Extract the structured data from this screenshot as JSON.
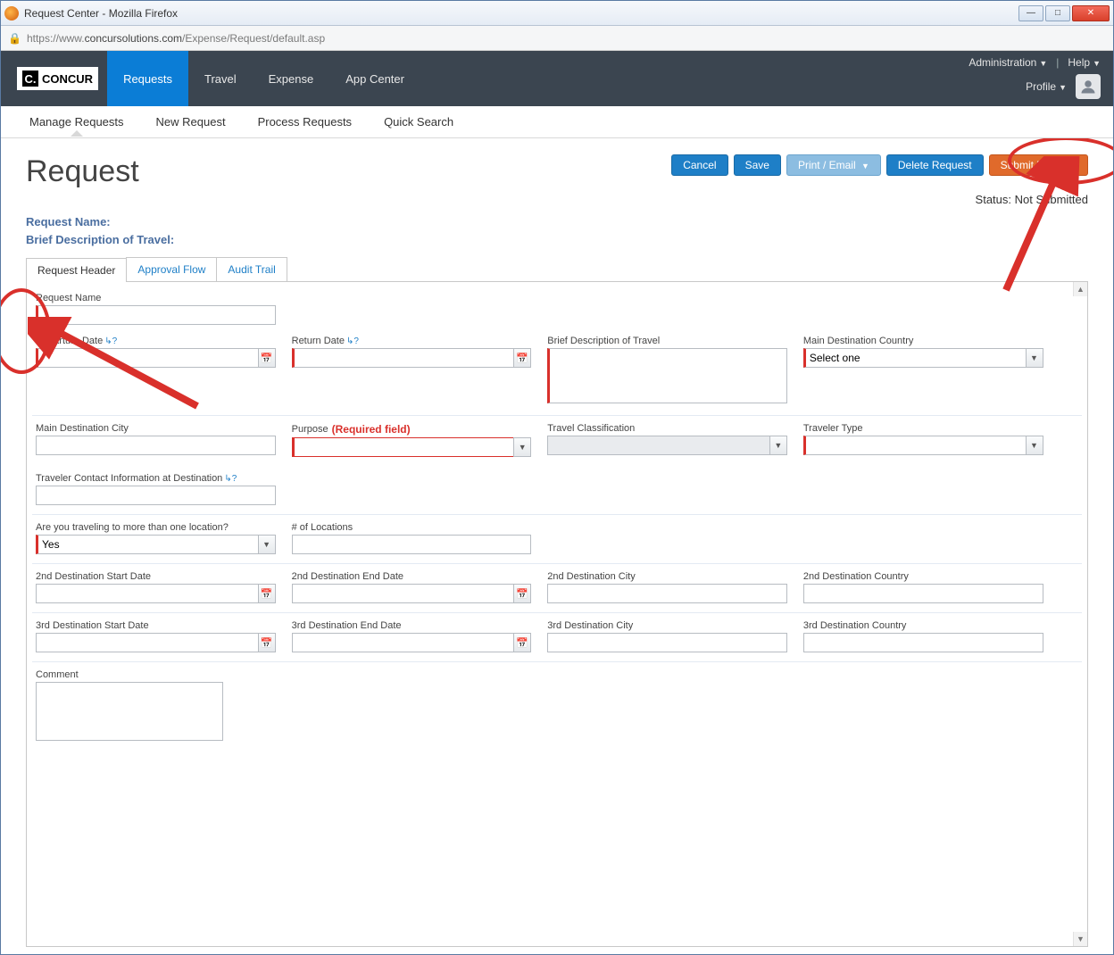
{
  "window": {
    "title": "Request Center - Mozilla Firefox"
  },
  "address": {
    "prefix": "https://www.",
    "domain": "concursolutions.com",
    "path": "/Expense/Request/default.asp"
  },
  "brand": {
    "logo_text": "CONCUR"
  },
  "nav": {
    "items": [
      "Requests",
      "Travel",
      "Expense",
      "App Center"
    ],
    "active_index": 0,
    "admin": "Administration",
    "help": "Help",
    "profile": "Profile"
  },
  "subnav": {
    "items": [
      "Manage Requests",
      "New Request",
      "Process Requests",
      "Quick Search"
    ],
    "active_index": 0
  },
  "page": {
    "title": "Request",
    "request_name_label": "Request Name:",
    "brief_desc_label": "Brief Description of Travel:",
    "status_label": "Status:",
    "status_value": "Not Submitted"
  },
  "actions": {
    "cancel": "Cancel",
    "save": "Save",
    "print_email": "Print / Email",
    "delete": "Delete Request",
    "submit": "Submit Request"
  },
  "tabs": {
    "items": [
      "Request Header",
      "Approval Flow",
      "Audit Trail"
    ],
    "active_index": 0
  },
  "form": {
    "request_name": {
      "label": "Request Name",
      "value": ""
    },
    "departure_date": {
      "label": "Departure Date",
      "value": ""
    },
    "return_date": {
      "label": "Return Date",
      "value": ""
    },
    "brief_desc": {
      "label": "Brief Description of Travel",
      "value": ""
    },
    "main_dest_country": {
      "label": "Main Destination Country",
      "value": "Select one"
    },
    "main_dest_city": {
      "label": "Main Destination City",
      "value": ""
    },
    "purpose": {
      "label": "Purpose",
      "required_text": "(Required field)",
      "value": ""
    },
    "travel_class": {
      "label": "Travel Classification",
      "value": ""
    },
    "traveler_type": {
      "label": "Traveler Type",
      "value": ""
    },
    "contact_info": {
      "label": "Traveler Contact Information at Destination",
      "value": ""
    },
    "multi_location": {
      "label": "Are you traveling to more than one location?",
      "value": "Yes"
    },
    "num_locations": {
      "label": "# of Locations",
      "value": ""
    },
    "d2_start": {
      "label": "2nd Destination Start Date",
      "value": ""
    },
    "d2_end": {
      "label": "2nd Destination End Date",
      "value": ""
    },
    "d2_city": {
      "label": "2nd Destination City",
      "value": ""
    },
    "d2_country": {
      "label": "2nd Destination Country",
      "value": ""
    },
    "d3_start": {
      "label": "3rd Destination Start Date",
      "value": ""
    },
    "d3_end": {
      "label": "3rd Destination End Date",
      "value": ""
    },
    "d3_city": {
      "label": "3rd Destination City",
      "value": ""
    },
    "d3_country": {
      "label": "3rd Destination Country",
      "value": ""
    },
    "comment": {
      "label": "Comment",
      "value": ""
    }
  }
}
